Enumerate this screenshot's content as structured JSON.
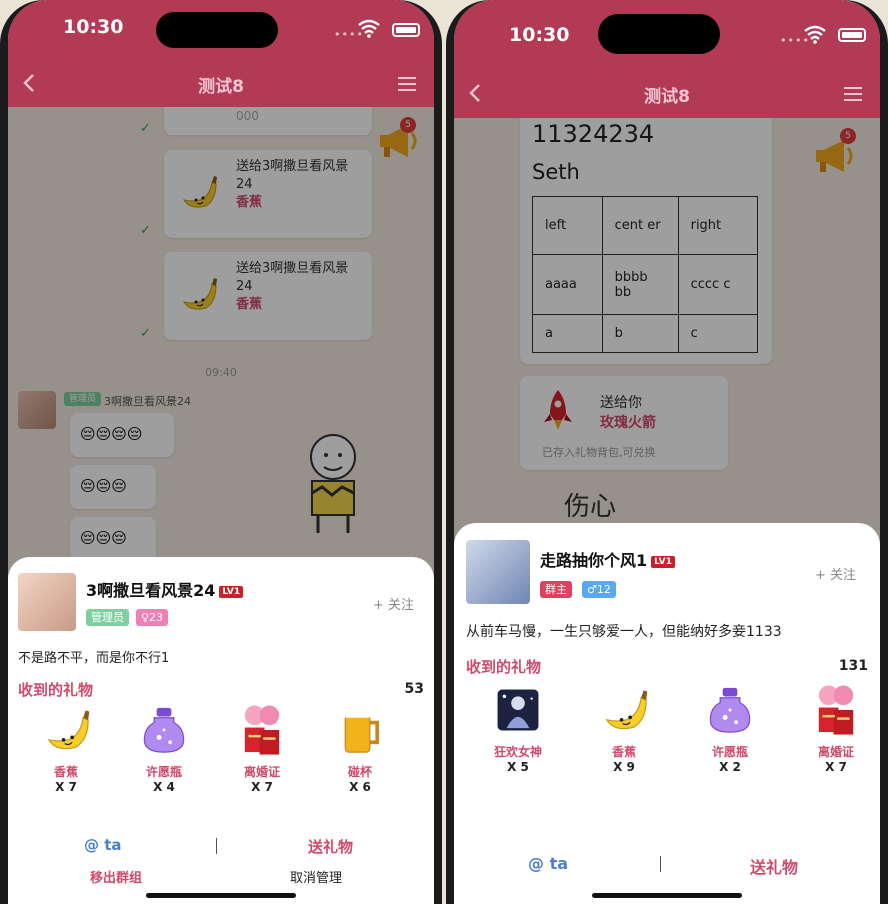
{
  "status": {
    "time": "10:30"
  },
  "nav": {
    "title": "测试8"
  },
  "megaphone_badge": "5",
  "left": {
    "chat": {
      "partial_text": "000",
      "gift_msgs": [
        {
          "text1": "送给3啊撒旦看风景",
          "text2": "24",
          "gift": "香蕉"
        },
        {
          "text1": "送给3啊撒旦看风景",
          "text2": "24",
          "gift": "香蕉"
        }
      ],
      "time": "09:40",
      "sender_role": "管理员",
      "sender_name": "3啊撒旦看风景24",
      "emoji_rows": [
        "😔😔😔😔",
        "😔😔😔",
        "😔😔😔"
      ]
    },
    "profile": {
      "name": "3啊撒旦看风景24",
      "level": "LV1",
      "role": "管理员",
      "gender": "♀23",
      "follow": "+ 关注",
      "signature": "不是路不平，而是你不行1",
      "gifts_title": "收到的礼物",
      "gifts_count": "53",
      "gifts": [
        {
          "name": "香蕉",
          "qty": "X 7"
        },
        {
          "name": "许愿瓶",
          "qty": "X 4"
        },
        {
          "name": "离婚证",
          "qty": "X 7"
        },
        {
          "name": "碰杯",
          "qty": "X 6"
        }
      ],
      "at": "@ ta",
      "send": "送礼物",
      "remove": "移出群组",
      "cancel_admin": "取消管理"
    }
  },
  "right": {
    "chat": {
      "lines": [
        "11324234",
        "Seth"
      ],
      "table": [
        [
          "left",
          "cent er",
          "right"
        ],
        [
          "aaaa",
          "bbbb bb",
          "cccc c"
        ],
        [
          "a",
          "b",
          "c"
        ]
      ],
      "gift_card": {
        "send_to": "送给你",
        "gift": "玫瑰火箭",
        "note": "已存入礼物背包,可兑换"
      },
      "handwriting": "伤心"
    },
    "profile": {
      "name": "走路抽你个风1",
      "level": "LV1",
      "role": "群主",
      "gender": "♂12",
      "follow": "+ 关注",
      "signature": "从前车马慢，一生只够爱一人，但能纳好多妾1133",
      "gifts_title": "收到的礼物",
      "gifts_count": "131",
      "gifts": [
        {
          "name": "狂欢女神",
          "qty": "X 5"
        },
        {
          "name": "香蕉",
          "qty": "X 9"
        },
        {
          "name": "许愿瓶",
          "qty": "X 2"
        },
        {
          "name": "离婚证",
          "qty": "X 7"
        }
      ],
      "at": "@ ta",
      "send": "送礼物"
    }
  },
  "colors": {
    "accent": "#b33a55",
    "gift": "#d04a6a",
    "at": "#4a7fd1"
  }
}
